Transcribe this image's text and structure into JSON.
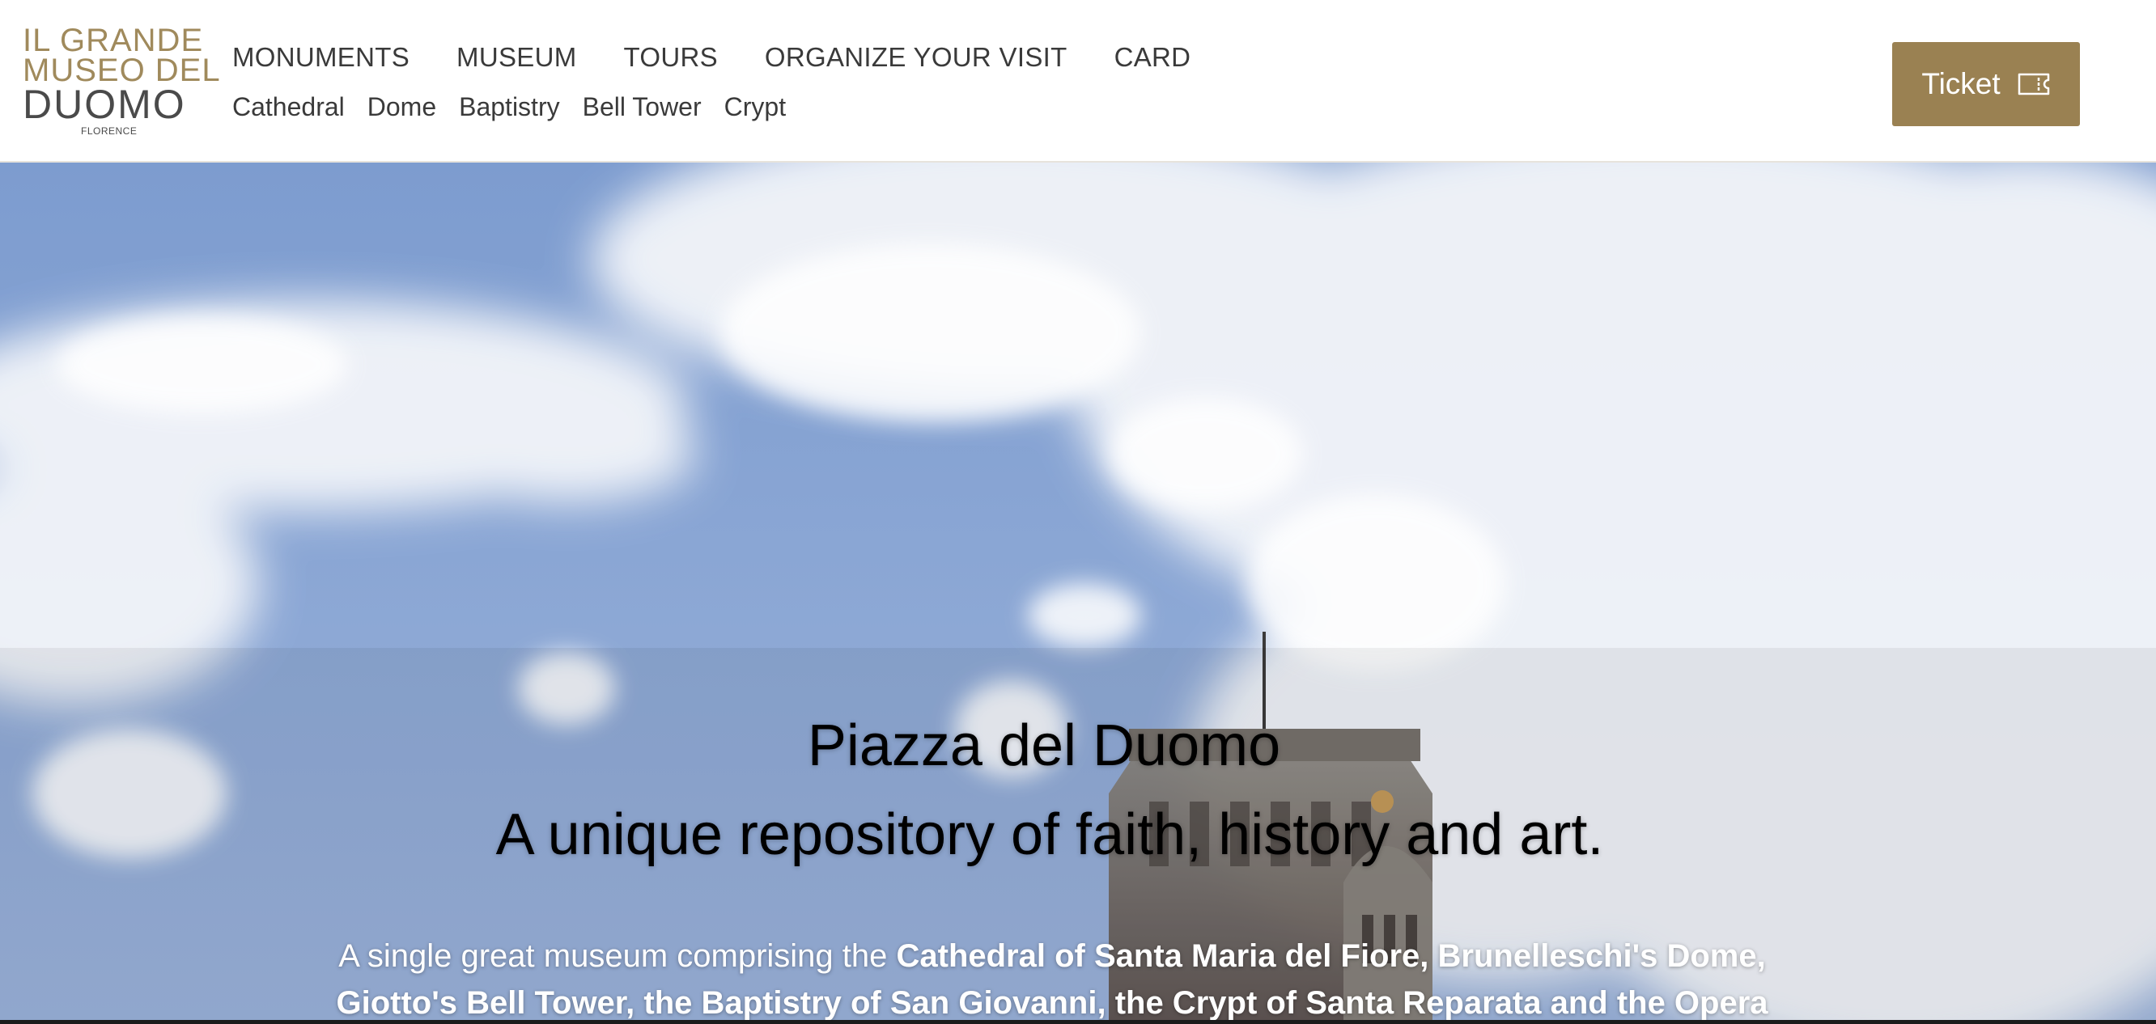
{
  "logo": {
    "line1": "IL GRANDE",
    "line2": "MUSEO DEL",
    "line3": "DUOMO",
    "line4": "FLORENCE"
  },
  "nav": {
    "main": [
      "MONUMENTS",
      "MUSEUM",
      "TOURS",
      "ORGANIZE YOUR VISIT",
      "CARD"
    ],
    "sub": [
      "Cathedral",
      "Dome",
      "Baptistry",
      "Bell Tower",
      "Crypt"
    ]
  },
  "ticket": {
    "label": "Ticket",
    "icon": "ticket-icon"
  },
  "hero": {
    "title": "Piazza del Duomo",
    "subtitle": "A unique repository of faith, history and art.",
    "desc_plain": "A single great museum comprising the ",
    "desc_bold": "Cathedral of Santa Maria del Fiore, Brunelleschi's Dome, Giotto's Bell Tower, the Baptistry of San Giovanni, the Crypt of Santa Reparata and the Opera"
  },
  "colors": {
    "brand_gold": "#9a8152",
    "logo_gold": "#a08a5c",
    "text_dark": "#3a3a3a",
    "sky_blue": "#8aa7d6"
  }
}
